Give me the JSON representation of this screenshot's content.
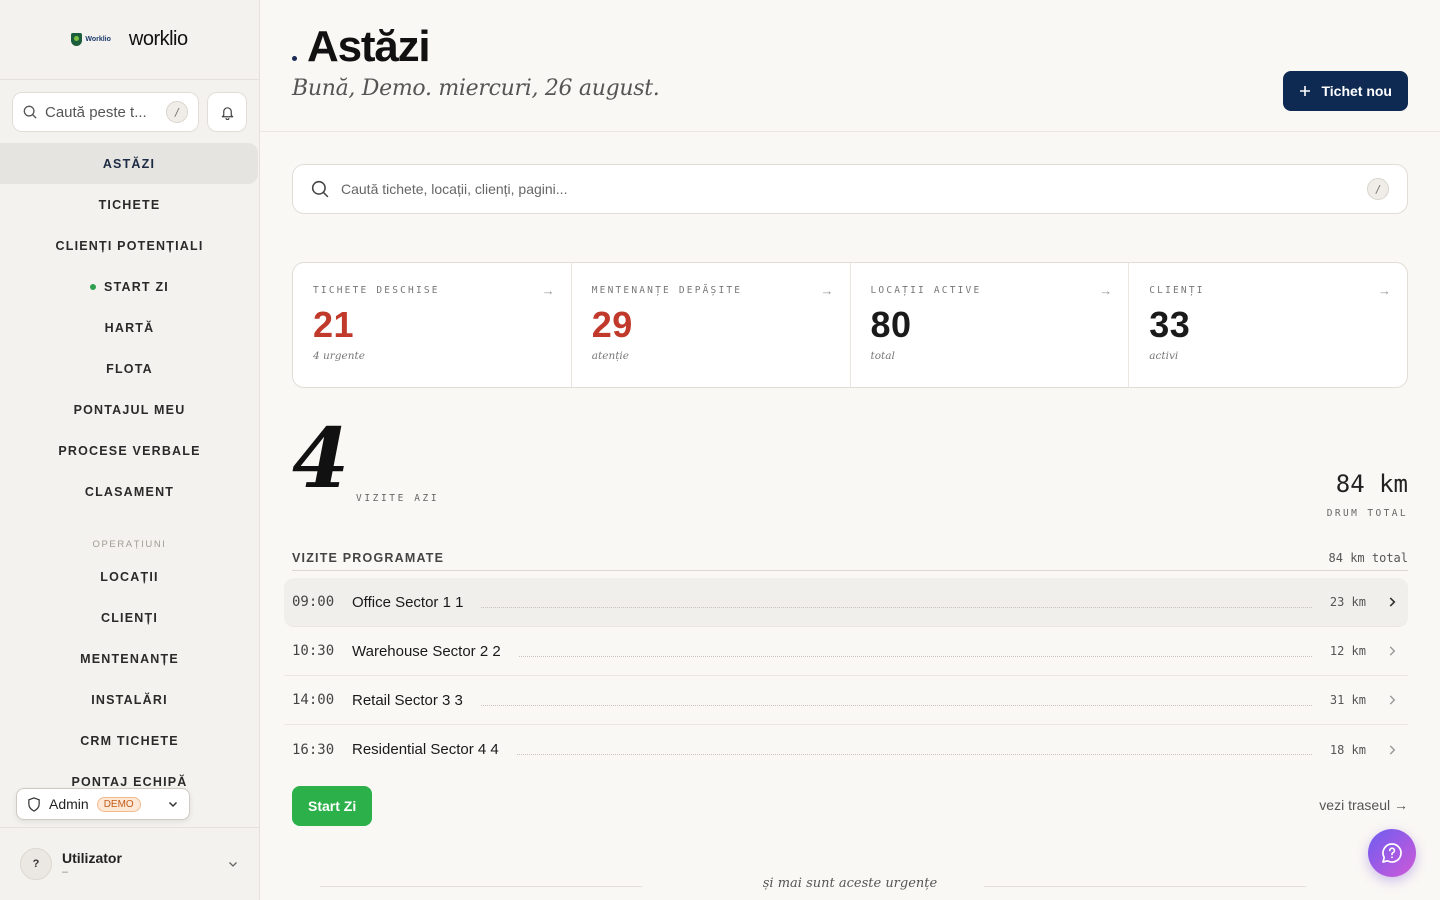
{
  "brand": {
    "logo_text": "Worklio",
    "name": "worklio"
  },
  "sidebar": {
    "search_placeholder": "Caută peste t...",
    "search_shortcut": "/",
    "nav_items": [
      {
        "label": "ASTĂZI",
        "active": true
      },
      {
        "label": "TICHETE"
      },
      {
        "label": "CLIENȚI POTENȚIALI"
      },
      {
        "label": "START ZI",
        "status_dot": "#2f9e4f"
      },
      {
        "label": "HARTĂ"
      },
      {
        "label": "FLOTA"
      },
      {
        "label": "PONTAJUL MEU"
      },
      {
        "label": "PROCESE VERBALE"
      },
      {
        "label": "CLASAMENT"
      }
    ],
    "section_label": "OPERAȚIUNI",
    "section_items": [
      {
        "label": "LOCAȚII"
      },
      {
        "label": "CLIENȚI"
      },
      {
        "label": "MENTENANȚE"
      },
      {
        "label": "INSTALĂRI"
      },
      {
        "label": "CRM TICHETE"
      },
      {
        "label": "PONTAJ ECHIPĂ"
      }
    ],
    "role": {
      "label": "Admin",
      "badge": "DEMO"
    },
    "user": {
      "initial": "?",
      "name": "Utilizator",
      "subtitle": "–"
    }
  },
  "header": {
    "title": "Astăzi",
    "greeting": "Bună, Demo. miercuri, 26 august.",
    "new_ticket_label": "Tichet nou"
  },
  "search": {
    "placeholder": "Caută tichete, locații, clienți, pagini...",
    "shortcut": "/"
  },
  "stats": [
    {
      "label": "TICHETE DESCHISE",
      "value": "21",
      "sub": "4 urgente",
      "color": "#c0392b"
    },
    {
      "label": "MENTENANȚE DEPĂȘITE",
      "value": "29",
      "sub": "atenție",
      "color": "#c0392b"
    },
    {
      "label": "LOCAȚII ACTIVE",
      "value": "80",
      "sub": "total",
      "color": "#111111"
    },
    {
      "label": "CLIENȚI",
      "value": "33",
      "sub": "activi",
      "color": "#111111"
    }
  ],
  "stat_arrow": "→",
  "today": {
    "visits_count": "4",
    "visits_label": "VIZITE AZI",
    "km_total": "84 km",
    "km_label": "DRUM TOTAL"
  },
  "schedule": {
    "title": "VIZITE PROGRAMATE",
    "total": "84 km total",
    "visits": [
      {
        "time": "09:00",
        "name": "Office Sector 1 1",
        "km": "23 km"
      },
      {
        "time": "10:30",
        "name": "Warehouse Sector 2 2",
        "km": "12 km"
      },
      {
        "time": "14:00",
        "name": "Retail Sector 3 3",
        "km": "31 km"
      },
      {
        "time": "16:30",
        "name": "Residential Sector 4 4",
        "km": "18 km"
      }
    ],
    "start_label": "Start Zi",
    "route_link": "vezi traseul →"
  },
  "footer_note": "și mai sunt aceste urgențe",
  "colors": {
    "accent": "#0f2a52",
    "success": "#2bb04a",
    "danger": "#c0392b"
  }
}
